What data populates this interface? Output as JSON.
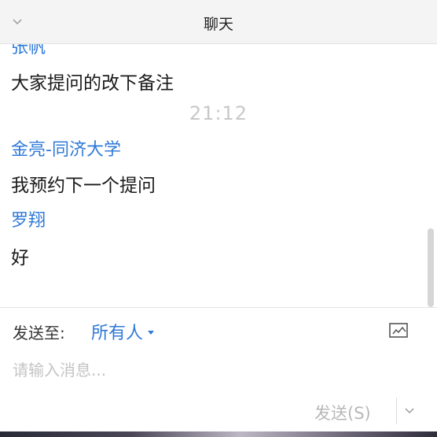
{
  "header": {
    "title": "聊天"
  },
  "messages": {
    "top_partial_sender": "张帆",
    "items": [
      {
        "text": "大家提问的改下备注"
      },
      {
        "timestamp": "21:12"
      },
      {
        "sender": "金亮-同济大学",
        "text": "我预约下一个提问"
      },
      {
        "sender": "罗翔",
        "text": "好"
      }
    ]
  },
  "composer": {
    "send_to_label": "发送至:",
    "recipient": "所有人",
    "input_placeholder": "请输入消息...",
    "input_value": "",
    "send_label": "发送(S)"
  },
  "icons": {
    "collapse": "chevron-down-icon",
    "screenshot": "screenshot-icon",
    "recipient_dropdown": "caret-down-icon",
    "send_options": "chevron-down-icon"
  },
  "colors": {
    "sender_name": "#2f7ad8",
    "timestamp": "#c8c8c8",
    "header_bg": "#f4f4f4"
  }
}
